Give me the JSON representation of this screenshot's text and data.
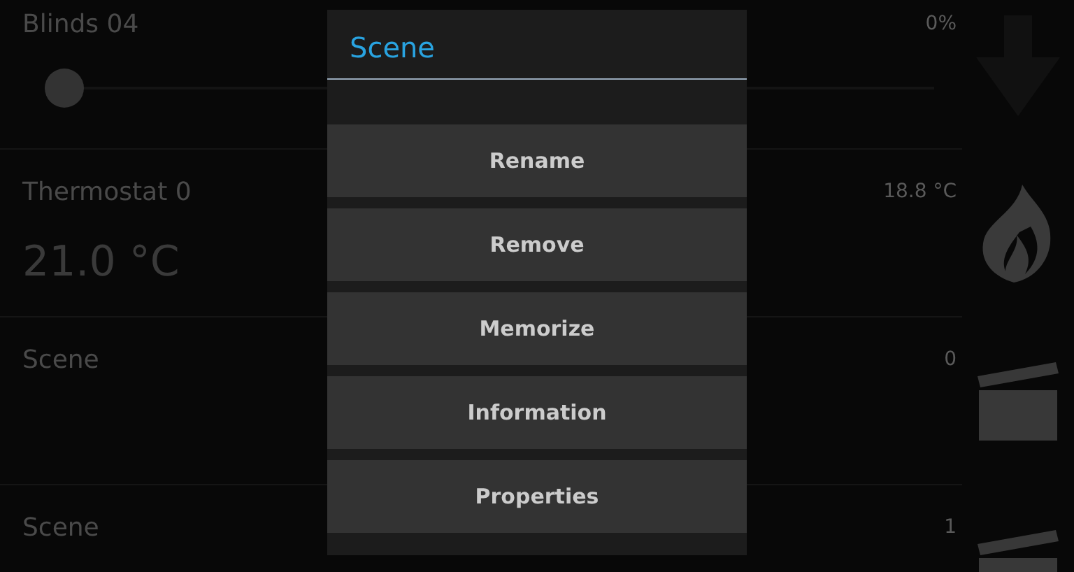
{
  "background_list": {
    "rows": [
      {
        "kind": "blinds",
        "title": "Blinds 04",
        "value": "0%",
        "level": 0
      },
      {
        "kind": "thermostat",
        "title": "Thermostat 0",
        "value": "18.8 °C",
        "setpoint": "21.0 °C"
      },
      {
        "kind": "scene",
        "title": "Scene",
        "value": "0"
      },
      {
        "kind": "scene",
        "title": "Scene",
        "value": "1"
      }
    ]
  },
  "dialog": {
    "title": "Scene",
    "options": [
      "Rename",
      "Remove",
      "Memorize",
      "Information",
      "Properties"
    ]
  }
}
